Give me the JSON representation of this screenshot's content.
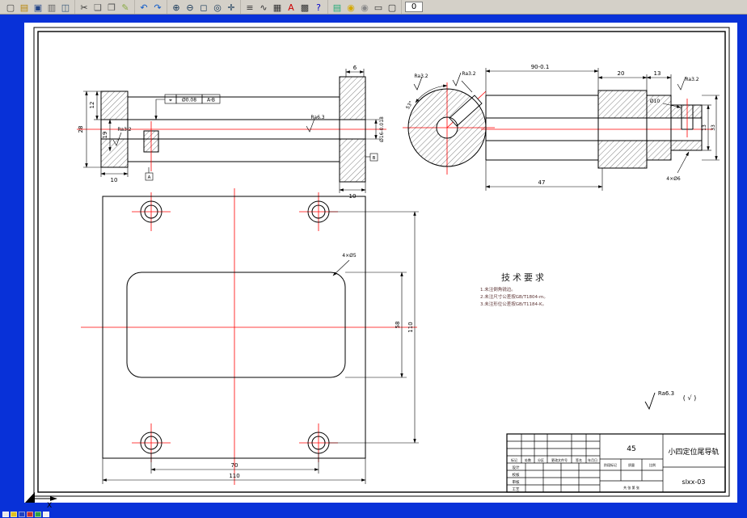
{
  "window": {
    "bg_color": "#0831d8",
    "toolbar_bg": "#d4d0c8",
    "canvas_color": "#ffffff",
    "centerline_red": "#ff0000"
  },
  "toolbar": {
    "groups": [
      [
        {
          "name": "new-file",
          "glyph": "▢",
          "color": "#444444"
        },
        {
          "name": "open-file",
          "glyph": "▤",
          "color": "#b8860b"
        },
        {
          "name": "save-file",
          "glyph": "▣",
          "color": "#224488"
        },
        {
          "name": "print",
          "glyph": "▥",
          "color": "#666666"
        },
        {
          "name": "print-preview",
          "glyph": "◫",
          "color": "#335577"
        }
      ],
      [
        {
          "name": "cut",
          "glyph": "✂",
          "color": "#333333"
        },
        {
          "name": "copy",
          "glyph": "❏",
          "color": "#555555"
        },
        {
          "name": "paste",
          "glyph": "❐",
          "color": "#555555"
        },
        {
          "name": "format-painter",
          "glyph": "✎",
          "color": "#88aa44"
        }
      ],
      [
        {
          "name": "undo",
          "glyph": "↶",
          "color": "#0a58c8"
        },
        {
          "name": "redo",
          "glyph": "↷",
          "color": "#0a58c8"
        }
      ],
      [
        {
          "name": "zoom-in",
          "glyph": "⊕",
          "color": "#113355"
        },
        {
          "name": "zoom-out",
          "glyph": "⊖",
          "color": "#113355"
        },
        {
          "name": "zoom-window",
          "glyph": "◻",
          "color": "#113355"
        },
        {
          "name": "zoom-all",
          "glyph": "◎",
          "color": "#113355"
        },
        {
          "name": "pan",
          "glyph": "✛",
          "color": "#113355"
        }
      ],
      [
        {
          "name": "layers",
          "glyph": "≡",
          "color": "#333333"
        },
        {
          "name": "linetype",
          "glyph": "∿",
          "color": "#333333"
        },
        {
          "name": "table",
          "glyph": "▦",
          "color": "#333333"
        },
        {
          "name": "text-style",
          "glyph": "A",
          "color": "#cc0000"
        },
        {
          "name": "modules",
          "glyph": "▩",
          "color": "#333333"
        },
        {
          "name": "help",
          "glyph": "?",
          "color": "#0000cc"
        }
      ],
      [
        {
          "name": "library",
          "glyph": "▤",
          "color": "#22aa77"
        },
        {
          "name": "bulb-on",
          "glyph": "◉",
          "color": "#d4a800"
        },
        {
          "name": "bulb-off",
          "glyph": "◉",
          "color": "#888888"
        },
        {
          "name": "toggle-box",
          "glyph": "▭",
          "color": "#333333"
        },
        {
          "name": "frame-box",
          "glyph": "▢",
          "color": "#333333"
        }
      ]
    ],
    "layer_value": "0"
  },
  "taskbar": {
    "icons": [
      {
        "name": "doc",
        "color": "#e8e8e8"
      },
      {
        "name": "app-yellow",
        "color": "#e0c020"
      },
      {
        "name": "app-blue",
        "color": "#2040c0"
      },
      {
        "name": "app-red",
        "color": "#c03030"
      },
      {
        "name": "app-green",
        "color": "#30a040"
      },
      {
        "name": "app-white",
        "color": "#f0f0f0"
      }
    ]
  },
  "drawing": {
    "shaft_section": {
      "dim_28": "28",
      "dim_12": "12",
      "dim_19": "19",
      "dim_10_left": "10",
      "dim_10_right": "10",
      "dim_6": "6",
      "gdt_symbol": "⌖",
      "gdt_value": "Ø0.08",
      "gdt_datum": "A-B",
      "ra_left": "Ra3.2",
      "ra_mid": "Ra6.3",
      "dia_right": "Ø16-0.018",
      "datum_a": "A",
      "datum_b": "B"
    },
    "shaft_end": {
      "ra_top": "Ra3.2",
      "ra_left": "Ra3.2",
      "angle": "53°"
    },
    "shaft_side": {
      "dim_90": "90-0.1",
      "dim_20": "20",
      "dim_13": "13",
      "ra_top": "Ra3.2",
      "dia_10": "Ø10",
      "holes": "4×Ø6",
      "dim_47": "47",
      "dim_13r": "13",
      "dim_33": "33"
    },
    "plate": {
      "holes": "4×Ø5",
      "dim_58": "58",
      "dim_110_v": "110",
      "dim_70": "70",
      "dim_110_h": "110"
    },
    "tech_req": {
      "title": "技术要求",
      "items": [
        "1.未注倒角锐边。",
        "2.未注尺寸公差按GB/T1804-m。",
        "3.未注形位公差按GB/T1184-K。"
      ]
    },
    "surface_note": {
      "ra": "Ra6.3",
      "suffix": "( √ )"
    },
    "axis_label": "X"
  },
  "titleblock": {
    "material": "45",
    "part_name": "小四定位尾导轨",
    "drawing_no": "slxx-03",
    "header_cells": [
      "标记",
      "处数",
      "分区",
      "更改文件号",
      "签名",
      "年月日"
    ],
    "left_rows": [
      "设计",
      "校核",
      "审核",
      "工艺"
    ],
    "mid_labels": [
      "阶段标记",
      "质量",
      "比例"
    ],
    "sheet_note": "共 张 第 张"
  }
}
